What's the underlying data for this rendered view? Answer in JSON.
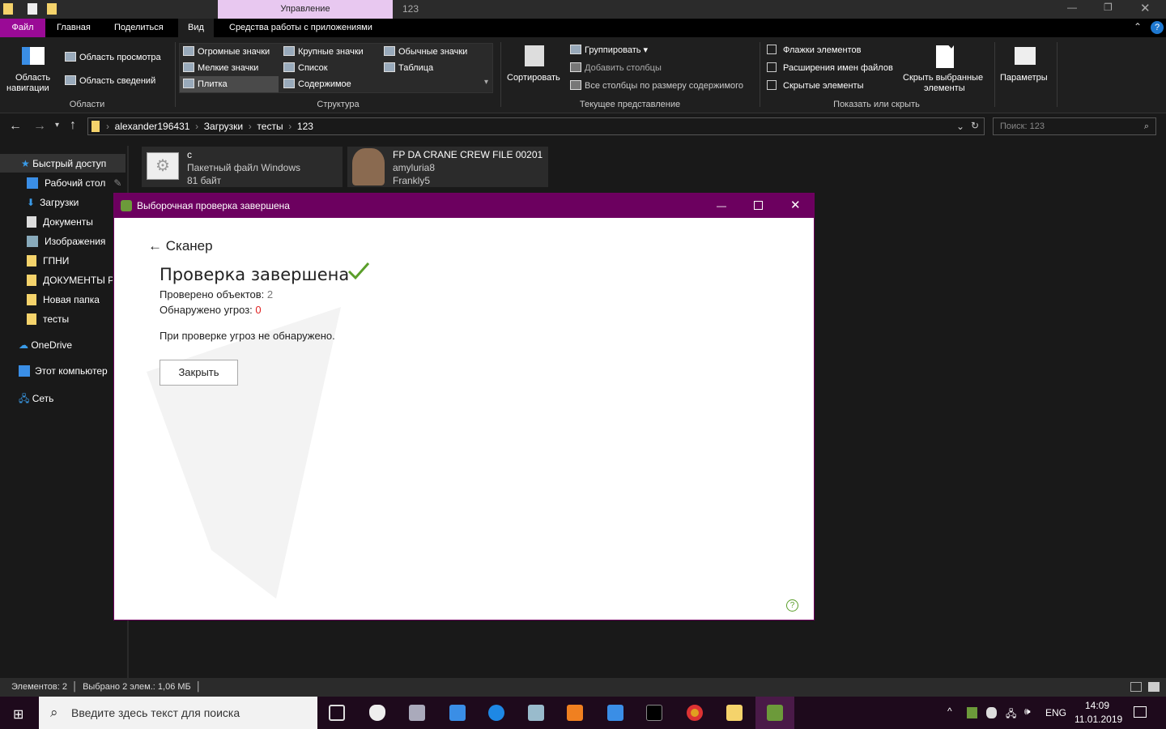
{
  "window": {
    "manage_tab": "Управление",
    "title": "123"
  },
  "tabs": [
    "Файл",
    "Главная",
    "Поделиться",
    "Вид",
    "Средства работы с приложениями"
  ],
  "ribbon": {
    "areas": {
      "nav_pane": "Область",
      "nav_pane2": "навигации",
      "preview": "Область просмотра",
      "details": "Область сведений",
      "group": "Области"
    },
    "layout": {
      "items": [
        "Огромные значки",
        "Крупные значки",
        "Обычные значки",
        "Мелкие значки",
        "Список",
        "Таблица",
        "Плитка",
        "Содержимое"
      ],
      "group": "Структура"
    },
    "view": {
      "sort": "Сортировать",
      "group_by": "Группировать",
      "add_columns": "Добавить столбцы",
      "fit_columns": "Все столбцы по размеру содержимого",
      "group": "Текущее представление"
    },
    "show": {
      "checkboxes": "Флажки элементов",
      "extensions": "Расширения имен файлов",
      "hidden": "Скрытые элементы",
      "hide_selected": "Скрыть выбранные",
      "hide_selected2": "элементы",
      "group": "Показать или скрыть"
    },
    "options": "Параметры"
  },
  "address": {
    "crumbs": [
      "alexander196431",
      "Загрузки",
      "тесты",
      "123"
    ],
    "search_placeholder": "Поиск: 123"
  },
  "sidebar": [
    "Быстрый доступ",
    "Рабочий стол",
    "Загрузки",
    "Документы",
    "Изображения",
    "ГПНИ",
    "ДОКУМЕНТЫ Р/",
    "Новая папка",
    "тесты",
    "OneDrive",
    "Этот компьютер",
    "Сеть"
  ],
  "files": [
    {
      "name": "c",
      "type": "Пакетный файл Windows",
      "size": "81 байт"
    },
    {
      "name": "FP DA  CRANE CREW FILE 00201",
      "l2": "amyluria8",
      "l3": "Frankly5"
    }
  ],
  "dialog": {
    "title": "Выборочная проверка завершена",
    "back": "Сканер",
    "heading": "Проверка завершена",
    "checked_label": "Проверено объектов: ",
    "checked": "2",
    "threats_label": "Обнаружено угроз: ",
    "threats": "0",
    "message": "При проверке угроз не обнаружено.",
    "close": "Закрыть",
    "help": "?"
  },
  "statusbar": {
    "items": "Элементов: 2",
    "selected": "Выбрано 2 элем.: 1,06 МБ"
  },
  "taskbar": {
    "search": "Введите здесь текст для поиска",
    "lang": "ENG",
    "time": "14:09",
    "date": "11.01.2019"
  }
}
